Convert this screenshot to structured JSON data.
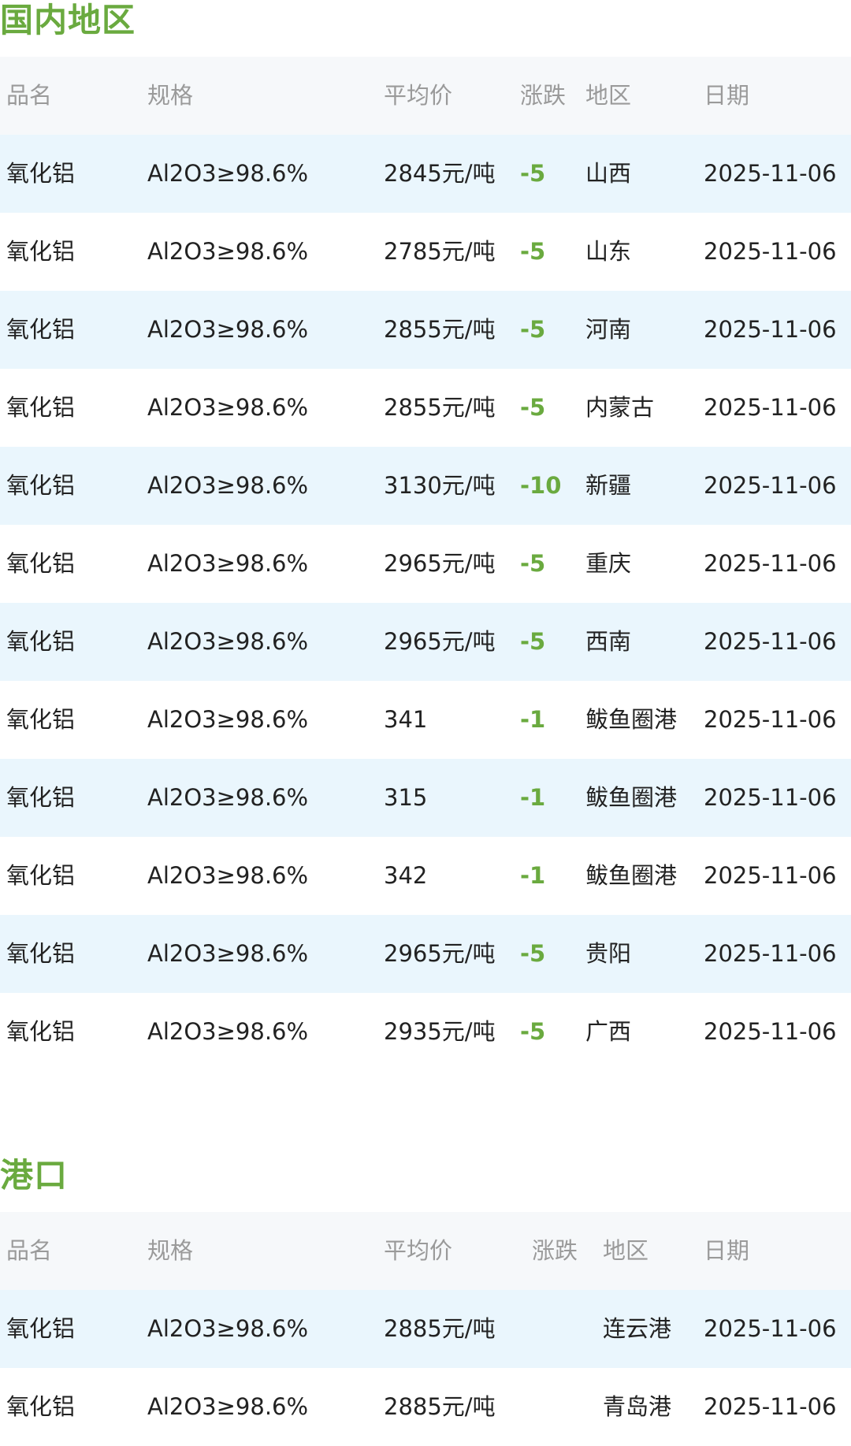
{
  "sections": [
    {
      "title": "国内地区",
      "headers": {
        "name": "品名",
        "spec": "规格",
        "price": "平均价",
        "change": "涨跌",
        "region": "地区",
        "date": "日期"
      },
      "rows": [
        {
          "name": "氧化铝",
          "spec": "Al2O3≥98.6%",
          "price": "2845元/吨",
          "change": "-5",
          "region": "山西",
          "date": "2025-11-06"
        },
        {
          "name": "氧化铝",
          "spec": "Al2O3≥98.6%",
          "price": "2785元/吨",
          "change": "-5",
          "region": "山东",
          "date": "2025-11-06"
        },
        {
          "name": "氧化铝",
          "spec": "Al2O3≥98.6%",
          "price": "2855元/吨",
          "change": "-5",
          "region": "河南",
          "date": "2025-11-06"
        },
        {
          "name": "氧化铝",
          "spec": "Al2O3≥98.6%",
          "price": "2855元/吨",
          "change": "-5",
          "region": "内蒙古",
          "date": "2025-11-06"
        },
        {
          "name": "氧化铝",
          "spec": "Al2O3≥98.6%",
          "price": "3130元/吨",
          "change": "-10",
          "region": "新疆",
          "date": "2025-11-06"
        },
        {
          "name": "氧化铝",
          "spec": "Al2O3≥98.6%",
          "price": "2965元/吨",
          "change": "-5",
          "region": "重庆",
          "date": "2025-11-06"
        },
        {
          "name": "氧化铝",
          "spec": "Al2O3≥98.6%",
          "price": "2965元/吨",
          "change": "-5",
          "region": "西南",
          "date": "2025-11-06"
        },
        {
          "name": "氧化铝",
          "spec": "Al2O3≥98.6%",
          "price": "341",
          "change": "-1",
          "region": "鲅鱼圈港",
          "date": "2025-11-06"
        },
        {
          "name": "氧化铝",
          "spec": "Al2O3≥98.6%",
          "price": "315",
          "change": "-1",
          "region": "鲅鱼圈港",
          "date": "2025-11-06"
        },
        {
          "name": "氧化铝",
          "spec": "Al2O3≥98.6%",
          "price": "342",
          "change": "-1",
          "region": "鲅鱼圈港",
          "date": "2025-11-06"
        },
        {
          "name": "氧化铝",
          "spec": "Al2O3≥98.6%",
          "price": "2965元/吨",
          "change": "-5",
          "region": "贵阳",
          "date": "2025-11-06"
        },
        {
          "name": "氧化铝",
          "spec": "Al2O3≥98.6%",
          "price": "2935元/吨",
          "change": "-5",
          "region": "广西",
          "date": "2025-11-06"
        }
      ]
    },
    {
      "title": "港口",
      "headers": {
        "name": "品名",
        "spec": "规格",
        "price": "平均价",
        "change": "涨跌",
        "region": "地区",
        "date": "日期"
      },
      "rows": [
        {
          "name": "氧化铝",
          "spec": "Al2O3≥98.6%",
          "price": "2885元/吨",
          "change": "",
          "region": "连云港",
          "date": "2025-11-06"
        },
        {
          "name": "氧化铝",
          "spec": "Al2O3≥98.6%",
          "price": "2885元/吨",
          "change": "",
          "region": "青岛港",
          "date": "2025-11-06"
        }
      ]
    }
  ],
  "colors": {
    "accent_green": "#6aaa3f",
    "stripe_blue": "#eaf6fd",
    "header_bg": "#f6f8fa",
    "header_text": "#9a9a9a"
  }
}
